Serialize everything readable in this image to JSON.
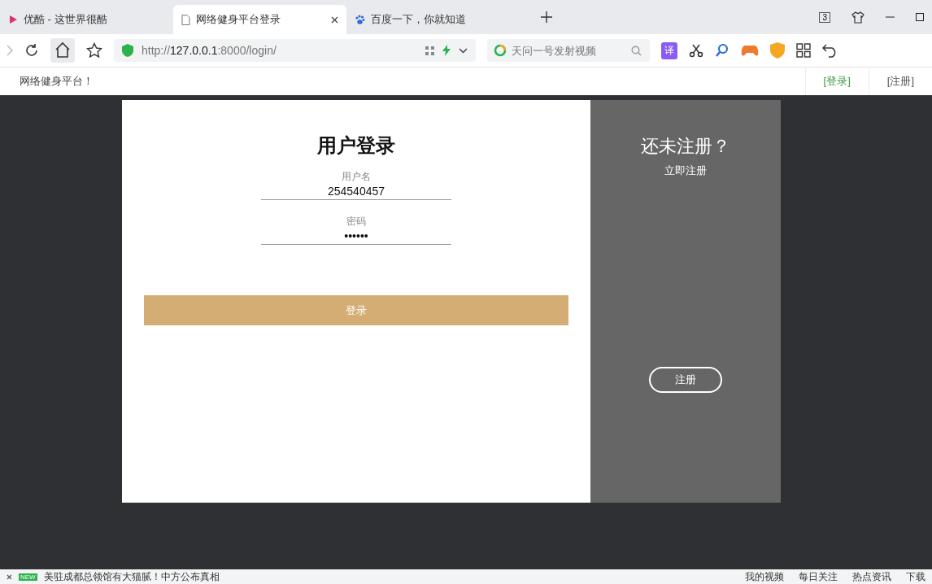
{
  "tabs": [
    {
      "title": "优酷 - 这世界很酷",
      "selected": false
    },
    {
      "title": "网络健身平台登录",
      "selected": true
    },
    {
      "title": "百度一下，你就知道",
      "selected": false
    }
  ],
  "tab_count": "3",
  "address_bar": {
    "url": "http://**127.0.0.1**:8000/login/"
  },
  "search": {
    "placeholder": "天问一号发射视频"
  },
  "translate_button": "译",
  "site_header": {
    "brand": "网络健身平台！",
    "links": [
      {
        "label": "[登录]",
        "selected": true
      },
      {
        "label": "[注册]",
        "selected": false
      }
    ]
  },
  "login_panel": {
    "title": "用户登录",
    "fields": [
      {
        "label": "用户名",
        "value": "254540457"
      },
      {
        "label": "密码",
        "value": "••••••"
      }
    ],
    "button": "登录"
  },
  "register_panel": {
    "title": "还未注册？",
    "subtitle": "立即注册",
    "button": "注册"
  },
  "status_bar": {
    "badge": "NEW",
    "headline": "美驻成都总领馆有大猫腻！中方公布真相",
    "items": [
      "我的视频",
      "每日关注",
      "热点资讯",
      "下载"
    ]
  }
}
